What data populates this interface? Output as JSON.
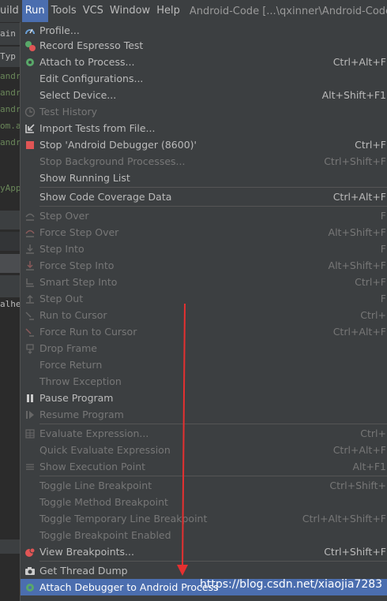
{
  "menubar": {
    "items": [
      "uild",
      "Run",
      "Tools",
      "VCS",
      "Window",
      "Help"
    ],
    "title": "Android-Code [...\\qxinner\\Android-Code]"
  },
  "background": {
    "rows": [
      "ain",
      "Typ",
      "andro",
      "andro",
      "andro",
      "om.a",
      "andro",
      "yApp",
      "alhe"
    ]
  },
  "menu": {
    "items": [
      {
        "label": "Profile...",
        "shortcut": "",
        "icon": "profile-icon",
        "disabled": false
      },
      {
        "label": "Record Espresso Test",
        "shortcut": "",
        "icon": "record-espresso-icon",
        "disabled": false
      },
      {
        "label": "Attach to Process...",
        "shortcut": "Ctrl+Alt+F",
        "icon": "attach-process-icon",
        "disabled": false
      },
      {
        "label": "Edit Configurations...",
        "shortcut": "",
        "icon": "",
        "disabled": false
      },
      {
        "label": "Select Device...",
        "shortcut": "Alt+Shift+F1",
        "icon": "",
        "disabled": false
      },
      {
        "label": "Test History",
        "shortcut": "",
        "icon": "clock-icon",
        "disabled": true
      },
      {
        "label": "Import Tests from File...",
        "shortcut": "",
        "icon": "import-tests-icon",
        "disabled": false
      },
      {
        "label": "Stop 'Android Debugger (8600)'",
        "shortcut": "Ctrl+F",
        "icon": "stop-icon",
        "disabled": false
      },
      {
        "label": "Stop Background Processes...",
        "shortcut": "Ctrl+Shift+F",
        "icon": "",
        "disabled": true
      },
      {
        "label": "Show Running List",
        "shortcut": "",
        "icon": "",
        "disabled": false
      },
      {
        "label": "Show Code Coverage Data",
        "shortcut": "Ctrl+Alt+F",
        "icon": "",
        "disabled": false
      },
      {
        "label": "Step Over",
        "shortcut": "F",
        "icon": "step-over-icon",
        "disabled": true
      },
      {
        "label": "Force Step Over",
        "shortcut": "Alt+Shift+F",
        "icon": "force-step-over-icon",
        "disabled": true
      },
      {
        "label": "Step Into",
        "shortcut": "F",
        "icon": "step-into-icon",
        "disabled": true
      },
      {
        "label": "Force Step Into",
        "shortcut": "Alt+Shift+F",
        "icon": "force-step-into-icon",
        "disabled": true
      },
      {
        "label": "Smart Step Into",
        "shortcut": "Ctrl+F",
        "icon": "smart-step-into-icon",
        "disabled": true
      },
      {
        "label": "Step Out",
        "shortcut": "F",
        "icon": "step-out-icon",
        "disabled": true
      },
      {
        "label": "Run to Cursor",
        "shortcut": "Ctrl+",
        "icon": "run-to-cursor-icon",
        "disabled": true
      },
      {
        "label": "Force Run to Cursor",
        "shortcut": "Ctrl+Alt+F",
        "icon": "force-run-to-cursor-icon",
        "disabled": true
      },
      {
        "label": "Drop Frame",
        "shortcut": "",
        "icon": "drop-frame-icon",
        "disabled": true
      },
      {
        "label": "Force Return",
        "shortcut": "",
        "icon": "",
        "disabled": true
      },
      {
        "label": "Throw Exception",
        "shortcut": "",
        "icon": "",
        "disabled": true
      },
      {
        "label": "Pause Program",
        "shortcut": "",
        "icon": "pause-icon",
        "disabled": false
      },
      {
        "label": "Resume Program",
        "shortcut": "",
        "icon": "resume-icon",
        "disabled": true
      },
      {
        "label": "Evaluate Expression...",
        "shortcut": "Ctrl+",
        "icon": "evaluate-icon",
        "disabled": true
      },
      {
        "label": "Quick Evaluate Expression",
        "shortcut": "Ctrl+Alt+F",
        "icon": "",
        "disabled": true
      },
      {
        "label": "Show Execution Point",
        "shortcut": "Alt+F1",
        "icon": "show-execution-point-icon",
        "disabled": true
      },
      {
        "label": "Toggle Line Breakpoint",
        "shortcut": "Ctrl+Shift+",
        "icon": "",
        "disabled": true
      },
      {
        "label": "Toggle Method Breakpoint",
        "shortcut": "",
        "icon": "",
        "disabled": true
      },
      {
        "label": "Toggle Temporary Line Breakpoint",
        "shortcut": "Ctrl+Alt+Shift+F",
        "icon": "",
        "disabled": true
      },
      {
        "label": "Toggle Breakpoint Enabled",
        "shortcut": "",
        "icon": "",
        "disabled": true
      },
      {
        "label": "View Breakpoints...",
        "shortcut": "Ctrl+Shift+F",
        "icon": "view-breakpoints-icon",
        "disabled": false
      },
      {
        "label": "Get Thread Dump",
        "shortcut": "",
        "icon": "camera-icon",
        "disabled": false
      },
      {
        "label": "Attach Debugger to Android Process",
        "shortcut": "",
        "icon": "attach-debugger-icon",
        "disabled": false,
        "highlighted": true
      }
    ]
  },
  "watermark": "https://blog.csdn.net/xiaojia7283",
  "colors": {
    "menubar": "#3c3f41",
    "highlight": "#4b6eaf",
    "annotation_arrow": "#e53030"
  }
}
